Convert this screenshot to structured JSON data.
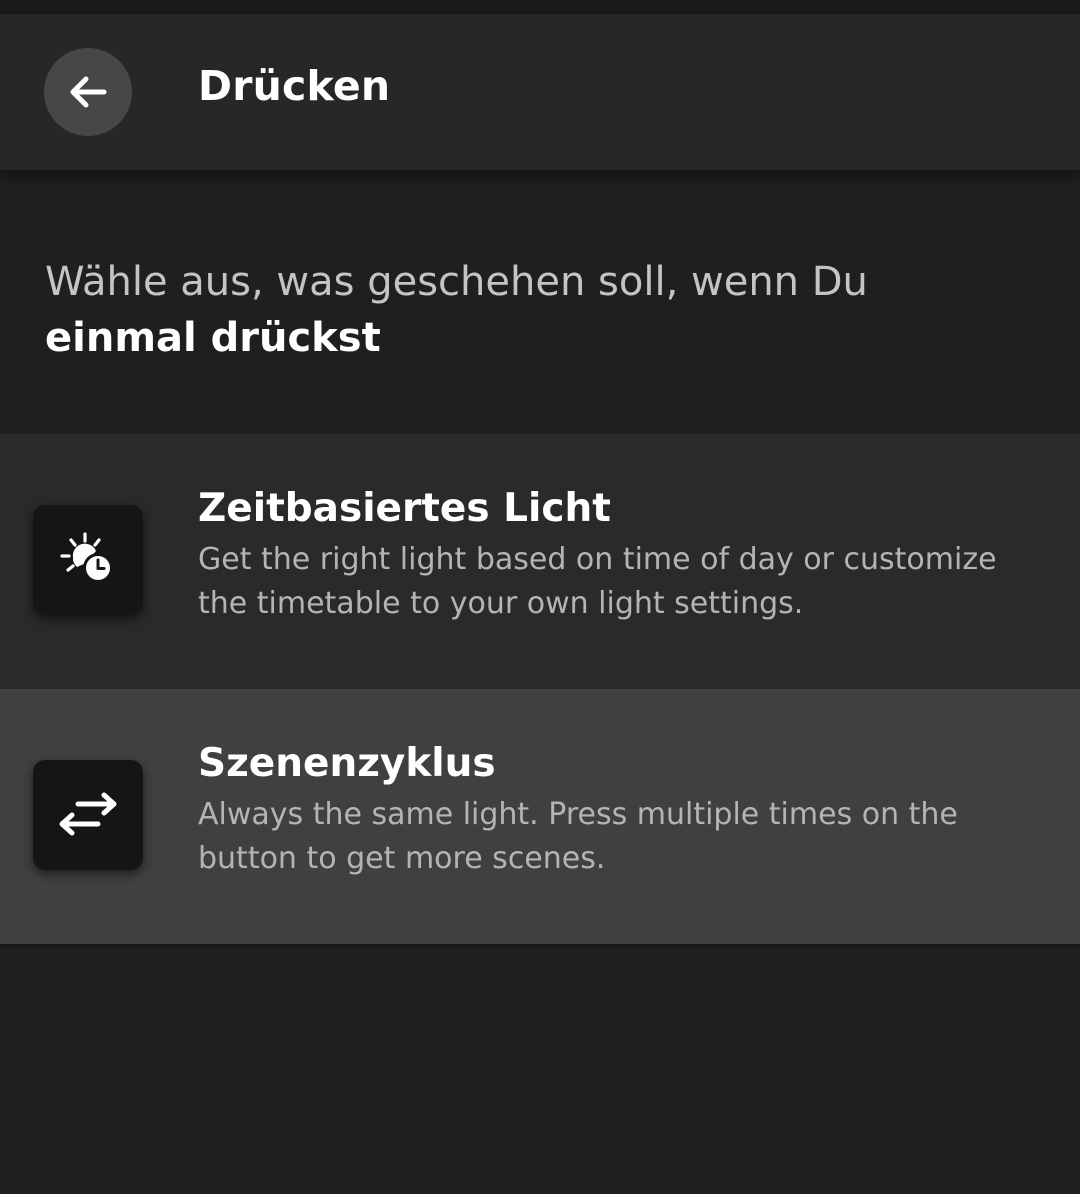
{
  "header": {
    "title": "Drücken",
    "back_icon": "arrow-left-icon"
  },
  "prompt": {
    "text": "Wähle aus, was geschehen soll, wenn Du",
    "emphasis": "einmal drückst"
  },
  "options": [
    {
      "title": "Zeitbasiertes Licht",
      "description": "Get the right light based on time of day or customize the timetable to your own light settings.",
      "icon": "sun-clock-icon",
      "selected": false
    },
    {
      "title": "Szenenzyklus",
      "description": "Always the same light. Press multiple times on the button to get more scenes.",
      "icon": "swap-arrows-icon",
      "selected": true
    }
  ],
  "colors": {
    "background": "#1f1f1f",
    "header": "#272727",
    "option_default": "#2a2a2a",
    "option_selected": "#404040",
    "tile": "#151515"
  }
}
